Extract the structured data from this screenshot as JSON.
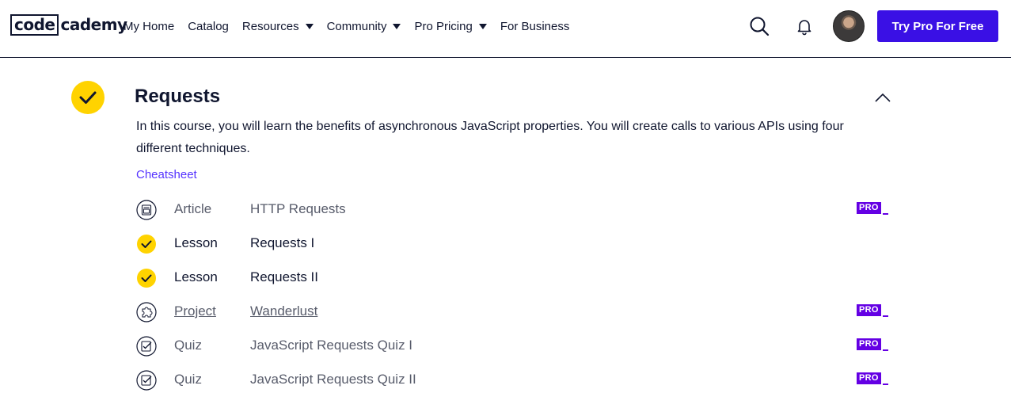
{
  "header": {
    "logo_boxed": "code",
    "logo_rest": "cademy",
    "nav": [
      {
        "label": "My Home",
        "dropdown": false
      },
      {
        "label": "Catalog",
        "dropdown": false
      },
      {
        "label": "Resources",
        "dropdown": true
      },
      {
        "label": "Community",
        "dropdown": true
      },
      {
        "label": "Pro Pricing",
        "dropdown": true
      },
      {
        "label": "For Business",
        "dropdown": false
      }
    ],
    "try_pro_label": "Try Pro For Free"
  },
  "module": {
    "title": "Requests",
    "completed": true,
    "description": "In this course, you will learn the benefits of asynchronous JavaScript properties. You will create calls to various APIs using four different techniques.",
    "cheatsheet_label": "Cheatsheet",
    "items": [
      {
        "type": "Article",
        "title": "HTTP Requests",
        "status": "locked",
        "icon": "article-icon",
        "pro": "PRO"
      },
      {
        "type": "Lesson",
        "title": "Requests I",
        "status": "completed",
        "icon": "check-icon",
        "pro": ""
      },
      {
        "type": "Lesson",
        "title": "Requests II",
        "status": "completed",
        "icon": "check-icon",
        "pro": ""
      },
      {
        "type": "Project",
        "title": "Wanderlust",
        "status": "locked",
        "icon": "puzzle-icon",
        "pro": "PRO"
      },
      {
        "type": "Quiz",
        "title": "JavaScript Requests Quiz I",
        "status": "locked",
        "icon": "quiz-icon",
        "pro": "PRO"
      },
      {
        "type": "Quiz",
        "title": "JavaScript Requests Quiz II",
        "status": "locked",
        "icon": "quiz-icon",
        "pro": "PRO"
      }
    ]
  },
  "colors": {
    "primary": "#3a10e5",
    "pro_badge": "#6400e4",
    "check_yellow": "#ffd300",
    "link": "#5533ff",
    "text": "#10162f"
  }
}
